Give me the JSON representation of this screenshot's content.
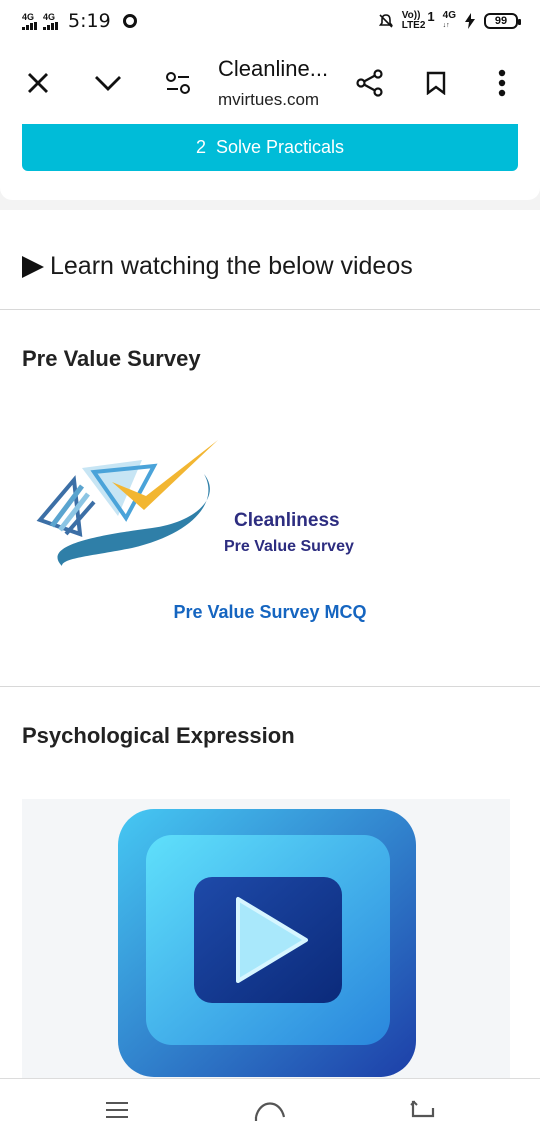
{
  "status_bar": {
    "sim1_net": "4G",
    "sim2_net": "4G",
    "time": "5:19",
    "volte_top": "Vo))",
    "volte_bottom": "LTE2",
    "sim_slot": "1",
    "net_right_top": "4G",
    "net_right_bottom": "↓↑",
    "battery": "99"
  },
  "toolbar": {
    "page_title": "Cleanline...",
    "page_domain": "mvirtues.com",
    "icons": [
      "close-icon",
      "chevron-down-icon",
      "page-settings-icon",
      "share-icon",
      "bookmark-icon",
      "more-vert-icon"
    ]
  },
  "practicals": {
    "number": "2",
    "label": "Solve Practicals"
  },
  "learn": {
    "heading": "Learn watching the below videos"
  },
  "sections": [
    {
      "title": "Pre Value Survey",
      "image_title": "Cleanliness",
      "image_subtitle": "Pre Value Survey",
      "link": "Pre Value Survey MCQ"
    },
    {
      "title": "Psychological Expression"
    }
  ],
  "colors": {
    "accent_teal": "#00bcd8",
    "link_blue": "#1565c0",
    "logo_navy": "#2d2d80",
    "logo_gold": "#f2b632",
    "logo_blue": "#4aa3d9"
  }
}
